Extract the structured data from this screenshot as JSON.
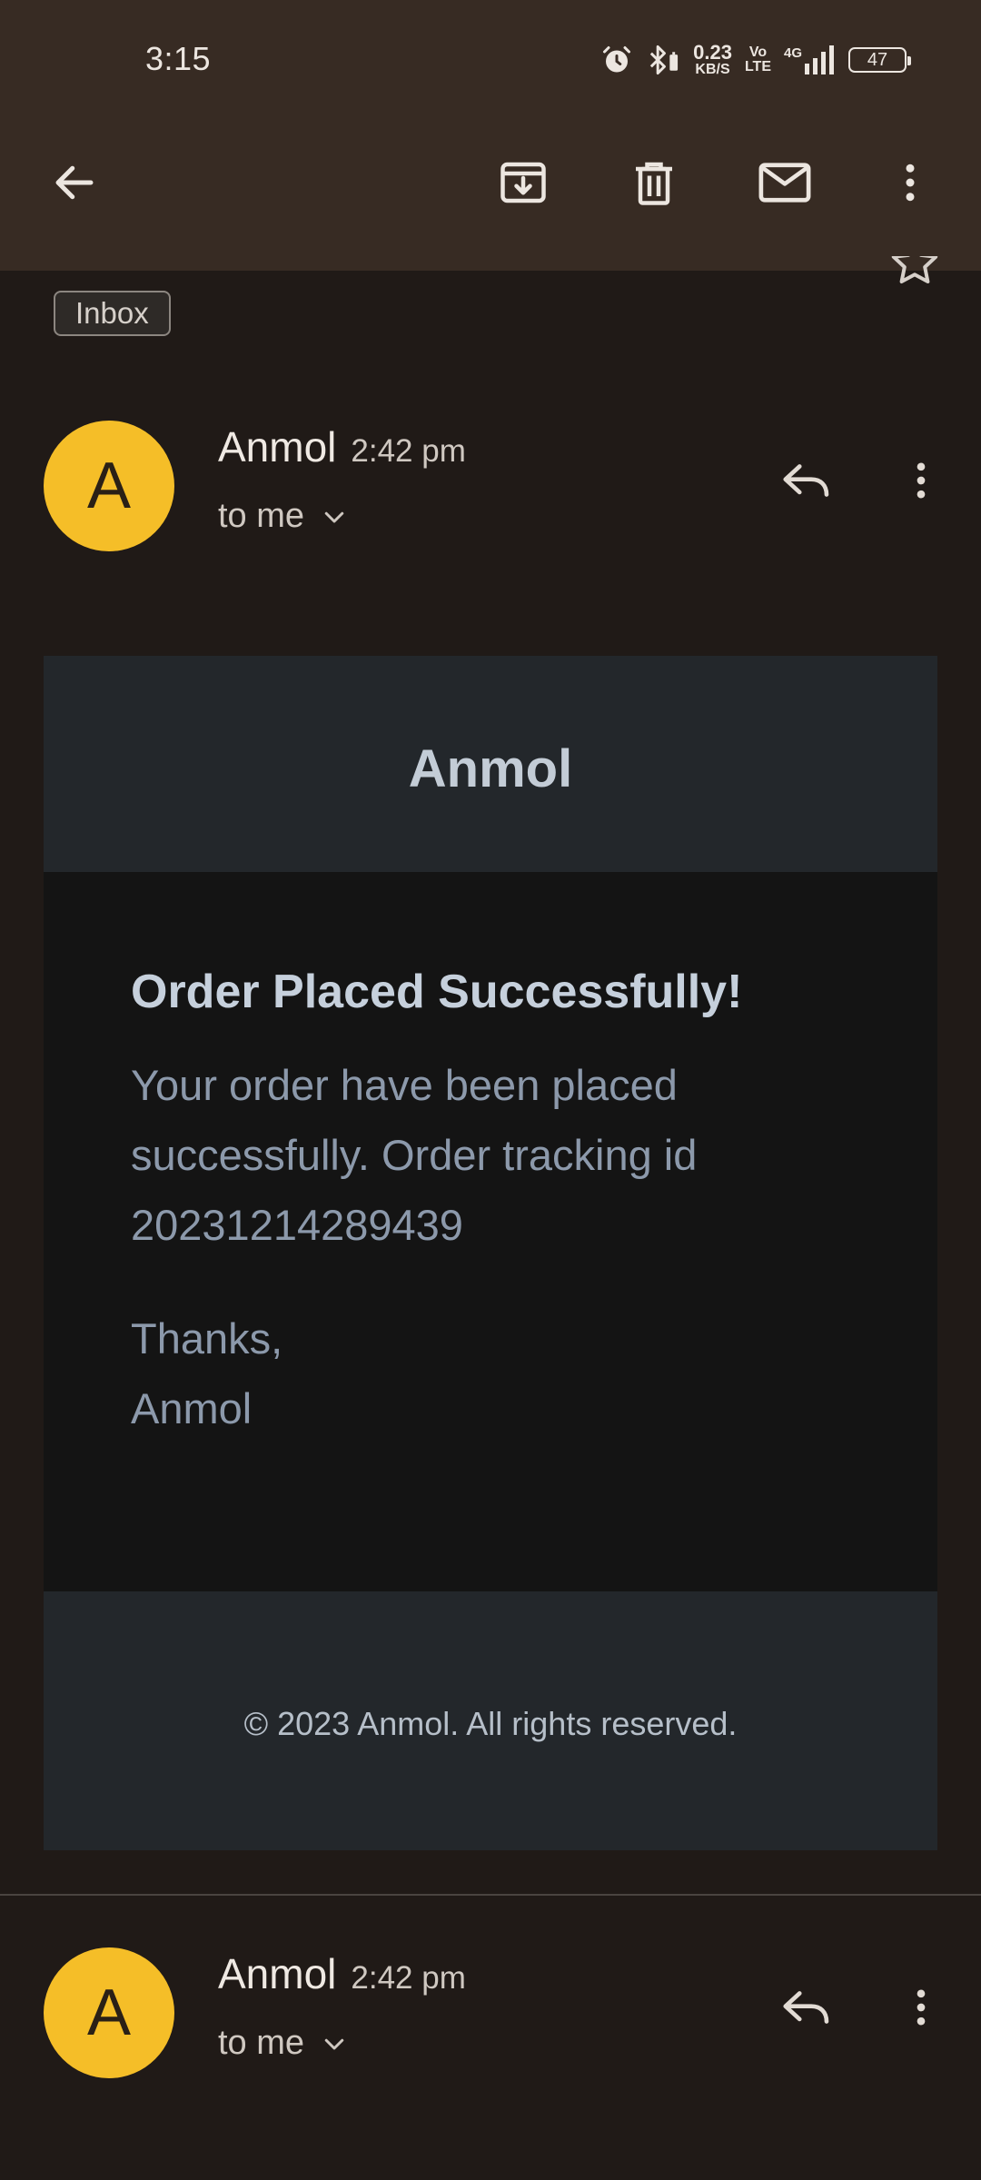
{
  "status_bar": {
    "time": "3:15",
    "net_speed_value": "0.23",
    "net_speed_unit": "KB/S",
    "volte_top": "Vo",
    "volte_bottom": "LTE",
    "network_type": "4G",
    "battery_level": "47"
  },
  "toolbar": {
    "icons": [
      "back-arrow-icon",
      "archive-icon",
      "delete-icon",
      "mark-unread-icon",
      "more-vert-icon"
    ]
  },
  "thread": {
    "label": "Inbox"
  },
  "messages": [
    {
      "sender": "Anmol",
      "initial": "A",
      "time": "2:42 pm",
      "recipient": "to me"
    },
    {
      "sender": "Anmol",
      "initial": "A",
      "time": "2:42 pm",
      "recipient": "to me"
    }
  ],
  "email": {
    "brand": "Anmol",
    "heading": "Order Placed Successfully!",
    "body": "Your order have been placed successfully. Order tracking id 20231214289439",
    "thanks": "Thanks,",
    "signature": "Anmol",
    "footer": "© 2023 Anmol. All rights reserved."
  },
  "colors": {
    "top_bar": "#372b23",
    "background": "#201a17",
    "avatar": "#f5be28",
    "email_header_footer": "#23272b",
    "email_body": "#141414",
    "heading_text": "#c6d0dc",
    "body_text": "#8c99ab"
  }
}
